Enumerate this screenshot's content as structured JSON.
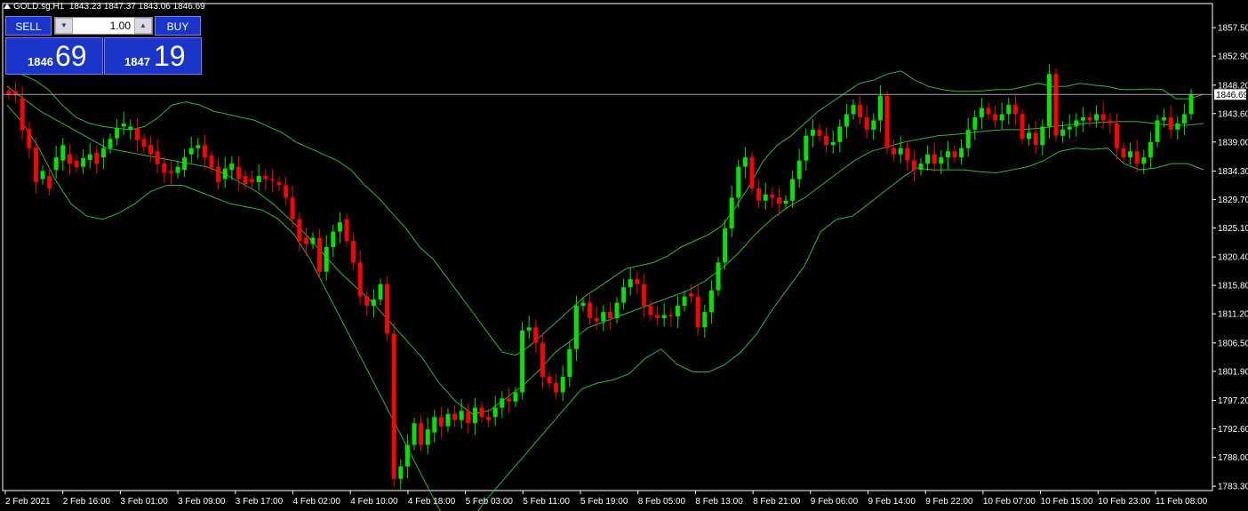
{
  "header": {
    "symbol": "GOLD.sg,H1",
    "ohlc": "1843.23 1847.37 1843.06 1846.69"
  },
  "trade_panel": {
    "sell_label": "SELL",
    "buy_label": "BUY",
    "lot_value": "1.00",
    "sell_price_small": "1846",
    "sell_price_big": "69",
    "buy_price_small": "1847",
    "buy_price_big": "19"
  },
  "price_axis": {
    "ticks": [
      "1857.50",
      "1852.90",
      "1848.20",
      "1843.60",
      "1839.00",
      "1834.30",
      "1829.70",
      "1825.10",
      "1820.40",
      "1815.80",
      "1811.20",
      "1806.50",
      "1801.90",
      "1797.20",
      "1792.60",
      "1788.00",
      "1783.30"
    ],
    "current_price_label": "1846.69"
  },
  "time_axis": {
    "ticks": [
      "2 Feb 2021",
      "2 Feb 16:00",
      "3 Feb 01:00",
      "3 Feb 09:00",
      "3 Feb 17:00",
      "4 Feb 02:00",
      "4 Feb 10:00",
      "4 Feb 18:00",
      "5 Feb 03:00",
      "5 Feb 11:00",
      "5 Feb 19:00",
      "8 Feb 05:00",
      "8 Feb 13:00",
      "8 Feb 21:00",
      "9 Feb 06:00",
      "9 Feb 14:00",
      "9 Feb 22:00",
      "10 Feb 07:00",
      "10 Feb 15:00",
      "10 Feb 23:00",
      "11 Feb 08:00"
    ]
  },
  "colors": {
    "background": "#000000",
    "bull": "#00e400",
    "bear": "#ff0000",
    "band": "#2db83d",
    "axis": "#ffffff",
    "panel": "#1a35c8"
  },
  "chart_data": {
    "type": "candlestick",
    "indicator": "bollinger-bands",
    "ylim": [
      1782.6,
      1861.4
    ],
    "current_price": 1846.69,
    "candle_pairs": [
      [
        1847.3,
        1846.7
      ],
      [
        1847.2,
        1846.5
      ],
      [
        1846.1,
        1840.9
      ],
      [
        1841.1,
        1838.0
      ],
      [
        1838.1,
        1832.5
      ],
      [
        1833.0,
        1834.3
      ],
      [
        1833.5,
        1831.5
      ],
      [
        1834.5,
        1836.5
      ],
      [
        1836.0,
        1838.5
      ],
      [
        1837.0,
        1835.5
      ],
      [
        1836.0,
        1834.9
      ],
      [
        1835.0,
        1836.4
      ],
      [
        1836.1,
        1837.0
      ],
      [
        1837.3,
        1835.5
      ],
      [
        1836.5,
        1838.0
      ],
      [
        1838.0,
        1839.5
      ],
      [
        1839.6,
        1841.3
      ],
      [
        1841.5,
        1842.0
      ],
      [
        1841.0,
        1841.5
      ],
      [
        1841.2,
        1839.3
      ],
      [
        1839.5,
        1838.2
      ],
      [
        1838.5,
        1837.0
      ],
      [
        1837.5,
        1835.4
      ],
      [
        1835.5,
        1834.0
      ],
      [
        1834.3,
        1834.0
      ],
      [
        1834.0,
        1835.0
      ],
      [
        1834.5,
        1836.5
      ],
      [
        1837.0,
        1838.0
      ],
      [
        1838.0,
        1838.5
      ],
      [
        1838.5,
        1836.5
      ],
      [
        1836.8,
        1834.8
      ],
      [
        1835.0,
        1832.5
      ],
      [
        1833.0,
        1834.7
      ],
      [
        1834.5,
        1835.5
      ],
      [
        1835.0,
        1833.0
      ],
      [
        1833.5,
        1832.2
      ],
      [
        1833.0,
        1832.5
      ],
      [
        1832.5,
        1833.5
      ],
      [
        1833.5,
        1833.0
      ],
      [
        1833.0,
        1832.8
      ],
      [
        1832.5,
        1832.0
      ],
      [
        1832.0,
        1830.0
      ],
      [
        1830.0,
        1826.5
      ],
      [
        1826.5,
        1823.0
      ],
      [
        1823.5,
        1822.5
      ],
      [
        1822.5,
        1823.5
      ],
      [
        1823.5,
        1818.0
      ],
      [
        1818.0,
        1822.0
      ],
      [
        1822.0,
        1824.5
      ],
      [
        1824.5,
        1826.0
      ],
      [
        1826.5,
        1823.0
      ],
      [
        1823.0,
        1819.5
      ],
      [
        1819.5,
        1814.0
      ],
      [
        1814.0,
        1812.5
      ],
      [
        1812.5,
        1813.5
      ],
      [
        1813.5,
        1816.0
      ],
      [
        1816.0,
        1808.0
      ],
      [
        1808.0,
        1784.5
      ],
      [
        1784.5,
        1786.5
      ],
      [
        1786.5,
        1790.0
      ],
      [
        1790.0,
        1793.5
      ],
      [
        1793.5,
        1790.0
      ],
      [
        1790.0,
        1792.5
      ],
      [
        1792.0,
        1794.5
      ],
      [
        1794.5,
        1793.0
      ],
      [
        1793.0,
        1795.0
      ],
      [
        1795.0,
        1794.0
      ],
      [
        1794.0,
        1795.5
      ],
      [
        1795.5,
        1793.5
      ],
      [
        1793.5,
        1796.0
      ],
      [
        1796.0,
        1794.5
      ],
      [
        1794.5,
        1794.0
      ],
      [
        1794.5,
        1796.0
      ],
      [
        1796.0,
        1797.5
      ],
      [
        1797.5,
        1797.0
      ],
      [
        1797.0,
        1798.5
      ],
      [
        1798.5,
        1808.5
      ],
      [
        1808.5,
        1809.0
      ],
      [
        1809.0,
        1806.5
      ],
      [
        1806.5,
        1801.0
      ],
      [
        1801.0,
        1800.0
      ],
      [
        1800.0,
        1798.5
      ],
      [
        1798.5,
        1801.0
      ],
      [
        1801.0,
        1805.5
      ],
      [
        1805.5,
        1812.5
      ],
      [
        1812.5,
        1813.0
      ],
      [
        1813.0,
        1810.5
      ],
      [
        1810.5,
        1810.0
      ],
      [
        1810.0,
        1811.5
      ],
      [
        1811.5,
        1810.5
      ],
      [
        1810.5,
        1813.0
      ],
      [
        1813.0,
        1815.5
      ],
      [
        1815.5,
        1816.8
      ],
      [
        1816.8,
        1816.0
      ],
      [
        1816.0,
        1812.5
      ],
      [
        1812.5,
        1811.0
      ],
      [
        1811.0,
        1810.5
      ],
      [
        1810.5,
        1811.0
      ],
      [
        1811.0,
        1810.8
      ],
      [
        1810.8,
        1812.5
      ],
      [
        1812.5,
        1814.0
      ],
      [
        1814.5,
        1814.0
      ],
      [
        1814.0,
        1809.0
      ],
      [
        1809.0,
        1811.5
      ],
      [
        1811.5,
        1815.0
      ],
      [
        1815.0,
        1819.5
      ],
      [
        1819.5,
        1825.0
      ],
      [
        1825.0,
        1830.0
      ],
      [
        1830.0,
        1835.0
      ],
      [
        1835.0,
        1836.5
      ],
      [
        1836.5,
        1831.5
      ],
      [
        1831.5,
        1829.5
      ],
      [
        1829.5,
        1830.5
      ],
      [
        1830.5,
        1830.0
      ],
      [
        1830.0,
        1829.0
      ],
      [
        1829.0,
        1829.5
      ],
      [
        1829.5,
        1833.0
      ],
      [
        1833.0,
        1836.0
      ],
      [
        1836.0,
        1840.0
      ],
      [
        1840.0,
        1841.0
      ],
      [
        1841.0,
        1840.0
      ],
      [
        1840.0,
        1838.5
      ],
      [
        1838.5,
        1839.0
      ],
      [
        1839.0,
        1841.5
      ],
      [
        1841.5,
        1843.5
      ],
      [
        1843.5,
        1845.0
      ],
      [
        1845.0,
        1843.0
      ],
      [
        1843.0,
        1841.0
      ],
      [
        1841.0,
        1842.5
      ],
      [
        1842.5,
        1846.5
      ],
      [
        1846.5,
        1838.0
      ],
      [
        1838.0,
        1837.0
      ],
      [
        1837.0,
        1838.0
      ],
      [
        1838.0,
        1836.0
      ],
      [
        1836.0,
        1834.5
      ],
      [
        1834.5,
        1835.5
      ],
      [
        1835.5,
        1837.0
      ],
      [
        1837.0,
        1835.5
      ],
      [
        1835.5,
        1836.5
      ],
      [
        1836.5,
        1837.5
      ],
      [
        1837.5,
        1836.5
      ],
      [
        1836.5,
        1838.0
      ],
      [
        1838.0,
        1841.0
      ],
      [
        1841.0,
        1843.0
      ],
      [
        1843.0,
        1844.5
      ],
      [
        1844.5,
        1843.5
      ],
      [
        1843.5,
        1842.5
      ],
      [
        1842.5,
        1843.5
      ],
      [
        1843.5,
        1845.0
      ],
      [
        1845.0,
        1843.5
      ],
      [
        1843.5,
        1839.5
      ],
      [
        1839.5,
        1840.5
      ],
      [
        1840.5,
        1838.5
      ],
      [
        1838.5,
        1841.5
      ],
      [
        1841.5,
        1850.0
      ],
      [
        1850.0,
        1840.0
      ],
      [
        1840.0,
        1841.0
      ],
      [
        1841.0,
        1841.5
      ],
      [
        1841.5,
        1842.5
      ],
      [
        1842.5,
        1843.0
      ],
      [
        1843.0,
        1842.5
      ],
      [
        1842.5,
        1843.5
      ],
      [
        1843.5,
        1842.5
      ],
      [
        1842.5,
        1842.0
      ],
      [
        1842.0,
        1838.0
      ],
      [
        1838.0,
        1836.5
      ],
      [
        1836.5,
        1837.5
      ],
      [
        1837.5,
        1835.5
      ],
      [
        1835.5,
        1836.5
      ],
      [
        1836.5,
        1839.0
      ],
      [
        1839.0,
        1842.5
      ],
      [
        1842.5,
        1843.0
      ],
      [
        1843.0,
        1841.0
      ],
      [
        1841.0,
        1842.0
      ],
      [
        1842.0,
        1843.5
      ],
      [
        1843.5,
        1846.7
      ]
    ],
    "bands": {
      "upper": [
        1851,
        1850,
        1849,
        1847.5,
        1845,
        1843,
        1842,
        1841.5,
        1841.2,
        1841,
        1841.5,
        1843,
        1845,
        1845.5,
        1845,
        1844,
        1843.5,
        1843,
        1842.5,
        1841.5,
        1840.5,
        1839,
        1838,
        1837,
        1836,
        1834.5,
        1832,
        1830,
        1827.5,
        1825,
        1822,
        1820,
        1817,
        1814,
        1811,
        1808,
        1805,
        1804.5,
        1806,
        1808,
        1810,
        1812,
        1814,
        1815.5,
        1817,
        1818.5,
        1819,
        1819.5,
        1820.5,
        1822,
        1823,
        1824,
        1825.5,
        1828.5,
        1832,
        1836,
        1838.5,
        1840,
        1842,
        1844,
        1845.5,
        1847,
        1848.5,
        1849,
        1850,
        1850.5,
        1849,
        1848,
        1847.5,
        1847.2,
        1847.2,
        1847.3,
        1847.5,
        1847.5,
        1848,
        1848.5,
        1848,
        1848,
        1848.5,
        1848.2,
        1848,
        1847.5,
        1847.5,
        1847.6,
        1847.5,
        1846,
        1846,
        1846.7
      ],
      "middle": [
        1848,
        1846,
        1844,
        1842.5,
        1841,
        1839.5,
        1838,
        1837.5,
        1837,
        1836.5,
        1836,
        1835.5,
        1835,
        1834,
        1832.5,
        1831,
        1829,
        1826.5,
        1824,
        1821,
        1818,
        1815.5,
        1813,
        1810,
        1807,
        1804,
        1800,
        1797,
        1795,
        1795.5,
        1797.5,
        1799.5,
        1802,
        1805,
        1807,
        1809,
        1810,
        1811,
        1812,
        1813,
        1814,
        1815,
        1816.5,
        1818.5,
        1821,
        1824,
        1826.5,
        1828.5,
        1830,
        1832,
        1834,
        1836,
        1837.5,
        1838.2,
        1839,
        1839.5,
        1840,
        1840.2,
        1840.5,
        1840.8,
        1841,
        1841,
        1841.2,
        1841.5,
        1841.8,
        1842,
        1842.2,
        1842.3,
        1842.3,
        1842,
        1841.7,
        1841.7,
        1842
      ],
      "lower": [
        1845,
        1842,
        1838,
        1833,
        1829,
        1827,
        1826.5,
        1827.5,
        1829,
        1831,
        1832,
        1832,
        1831,
        1830,
        1829,
        1828.5,
        1828,
        1826.5,
        1824,
        1820,
        1815,
        1810,
        1805,
        1800,
        1795,
        1790,
        1785,
        1780,
        1776,
        1777.5,
        1781,
        1784,
        1787,
        1790,
        1793,
        1796,
        1799,
        1800,
        1800.5,
        1801.5,
        1804,
        1805.5,
        1803,
        1801.8,
        1801.8,
        1803,
        1805,
        1808,
        1812,
        1815.5,
        1819,
        1824.5,
        1826.5,
        1827,
        1829,
        1831,
        1833,
        1834.8,
        1834.5,
        1834.5,
        1834.5,
        1834.2,
        1834,
        1834.5,
        1835,
        1836,
        1837.5,
        1838,
        1837.8,
        1838,
        1835.5,
        1834.5,
        1834.8,
        1835.5,
        1835.5,
        1834.5
      ]
    }
  }
}
